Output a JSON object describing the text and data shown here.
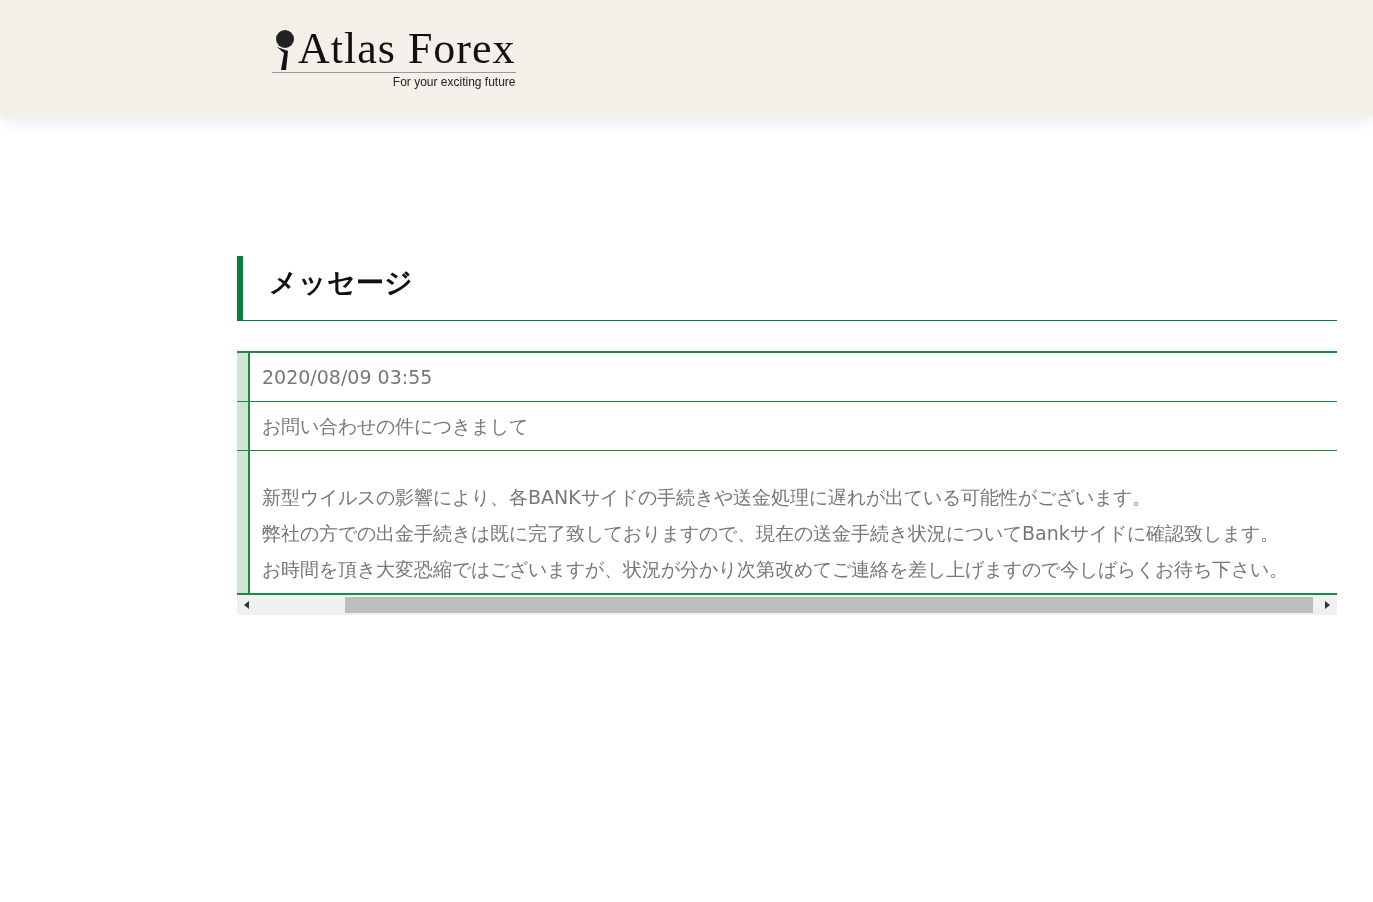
{
  "header": {
    "logo": "Atlas Forex",
    "tagline": "For your exciting future"
  },
  "heading": "メッセージ",
  "message": {
    "date": "2020/08/09 03:55",
    "subject": "お問い合わせの件につきまして",
    "body_lines": [
      "新型ウイルスの影響により、各BANKサイドの手続きや送金処理に遅れが出ている可能性がございます。",
      "弊社の方での出金手続きは既に完了致しておりますので、現在の送金手続き状況についてBankサイドに確認致します。",
      "お時間を頂き大変恐縮ではございますが、状況が分かり次第改めてご連絡を差し上げますので今しばらくお待ち下さい。"
    ]
  }
}
